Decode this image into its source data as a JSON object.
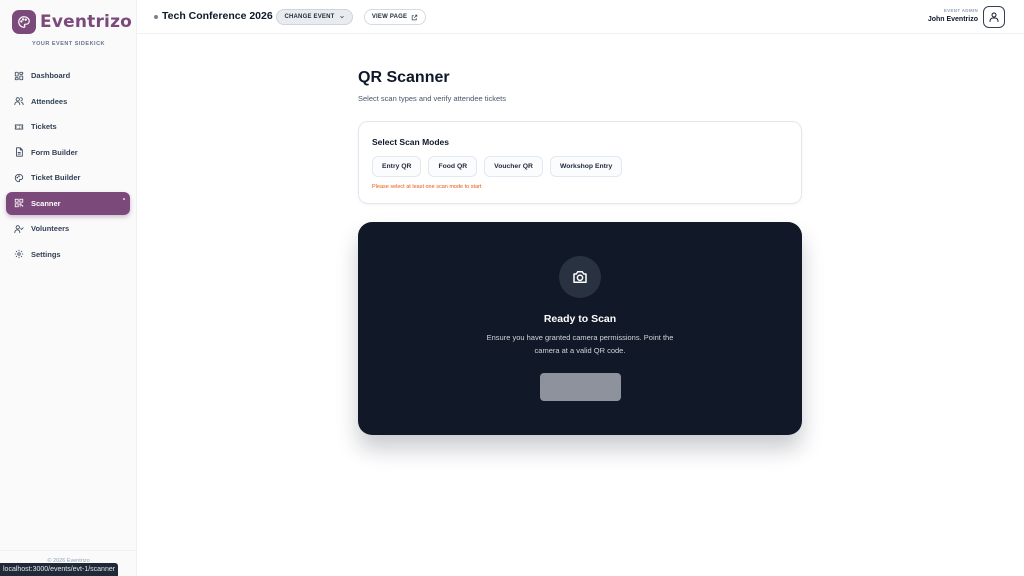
{
  "app": {
    "brand_name": "Eventrizo",
    "tagline": "YOUR EVENT SIDEKICK",
    "footer_text": "© 2026 Eventrizo",
    "status_url": "localhost:3000/events/evt-1/scanner",
    "accent_color": "#7b4a7a"
  },
  "sidebar": {
    "items": [
      {
        "label": "Dashboard",
        "icon": "dashboard-icon",
        "active": false
      },
      {
        "label": "Attendees",
        "icon": "users-icon",
        "active": false
      },
      {
        "label": "Tickets",
        "icon": "ticket-icon",
        "active": false
      },
      {
        "label": "Form Builder",
        "icon": "form-icon",
        "active": false
      },
      {
        "label": "Ticket Builder",
        "icon": "palette-icon",
        "active": false
      },
      {
        "label": "Scanner",
        "icon": "qr-icon",
        "active": true
      },
      {
        "label": "Volunteers",
        "icon": "user-check-icon",
        "active": false
      },
      {
        "label": "Settings",
        "icon": "gear-icon",
        "active": false
      }
    ]
  },
  "header": {
    "event_title": "Tech Conference 2026",
    "change_event_label": "CHANGE EVENT",
    "view_page_label": "VIEW PAGE",
    "user_role": "EVENT ADMIN",
    "user_name": "John Eventrizo"
  },
  "main": {
    "title": "QR Scanner",
    "subtitle": "Select scan types and verify attendee tickets",
    "modes": {
      "title": "Select Scan Modes",
      "options": [
        "Entry QR",
        "Food QR",
        "Voucher QR",
        "Workshop Entry"
      ],
      "warning": "Please select at least one scan mode to start"
    },
    "scanner": {
      "title": "Ready to Scan",
      "description": "Ensure you have granted camera permissions. Point the camera at a valid QR code.",
      "start_label": ""
    }
  }
}
